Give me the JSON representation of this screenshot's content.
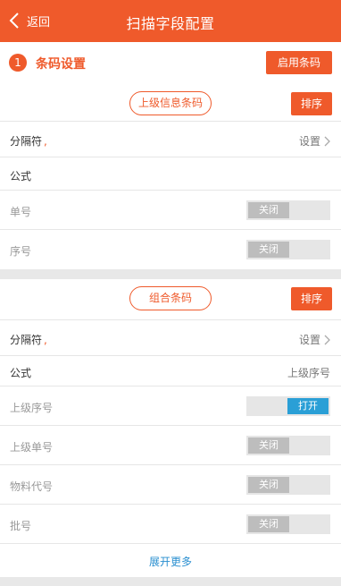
{
  "header": {
    "back_label": "返回",
    "title": "扫描字段配置"
  },
  "section1": {
    "number": "1",
    "title": "条码设置",
    "enable_button": "启用条码"
  },
  "group1": {
    "pill_label": "上级信息条码",
    "sort_button": "排序",
    "separator_label": "分隔符",
    "separator_value": ",",
    "settings_link": "设置",
    "formula_label": "公式",
    "fields": [
      {
        "label": "单号",
        "state": "关闭"
      },
      {
        "label": "序号",
        "state": "关闭"
      }
    ]
  },
  "group2": {
    "pill_label": "组合条码",
    "sort_button": "排序",
    "separator_label": "分隔符",
    "separator_value": ",",
    "settings_link": "设置",
    "formula_label": "公式",
    "formula_value": "上级序号",
    "fields": [
      {
        "label": "上级序号",
        "state": "打开"
      },
      {
        "label": "上级单号",
        "state": "关闭"
      },
      {
        "label": "物料代号",
        "state": "关闭"
      },
      {
        "label": "批号",
        "state": "关闭"
      }
    ],
    "expand_label": "展开更多"
  },
  "colors": {
    "accent": "#ef5a2b",
    "toggle_on": "#2a9fd6",
    "link": "#2a8fd0"
  }
}
